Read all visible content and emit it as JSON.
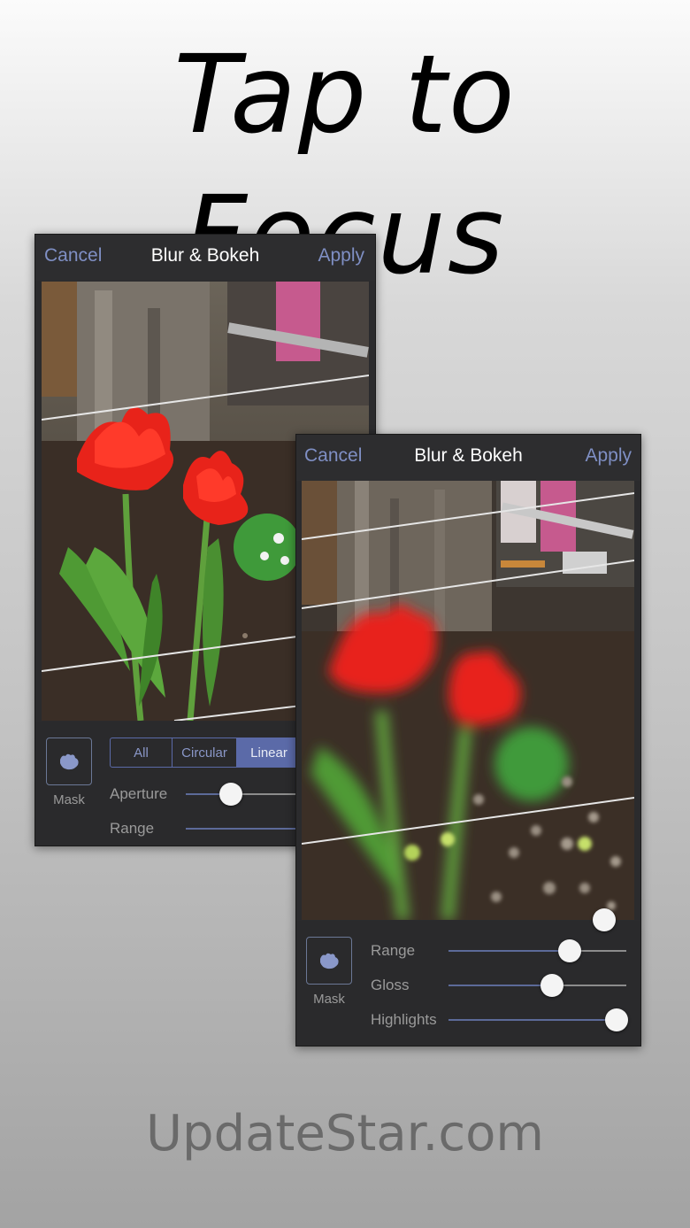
{
  "headline": "Tap to Focus",
  "watermark": "UpdateStar.com",
  "back_screen": {
    "nav": {
      "cancel": "Cancel",
      "title": "Blur & Bokeh",
      "apply": "Apply"
    },
    "mask_label": "Mask",
    "mode_tabs": [
      {
        "label": "All",
        "active": false
      },
      {
        "label": "Circular",
        "active": false
      },
      {
        "label": "Linear",
        "active": true
      }
    ],
    "sliders": [
      {
        "label": "Aperture",
        "value": 0.4
      },
      {
        "label": "Range",
        "value": 0.98
      }
    ]
  },
  "front_screen": {
    "nav": {
      "cancel": "Cancel",
      "title": "Blur & Bokeh",
      "apply": "Apply"
    },
    "mask_label": "Mask",
    "sliders": [
      {
        "label": "Range",
        "value": 0.67
      },
      {
        "label": "Gloss",
        "value": 0.58
      },
      {
        "label": "Highlights",
        "value": 0.98
      }
    ]
  },
  "colors": {
    "accent": "#7f8fc4",
    "panel": "#2a2a2c",
    "tulip": "#e8231a"
  }
}
